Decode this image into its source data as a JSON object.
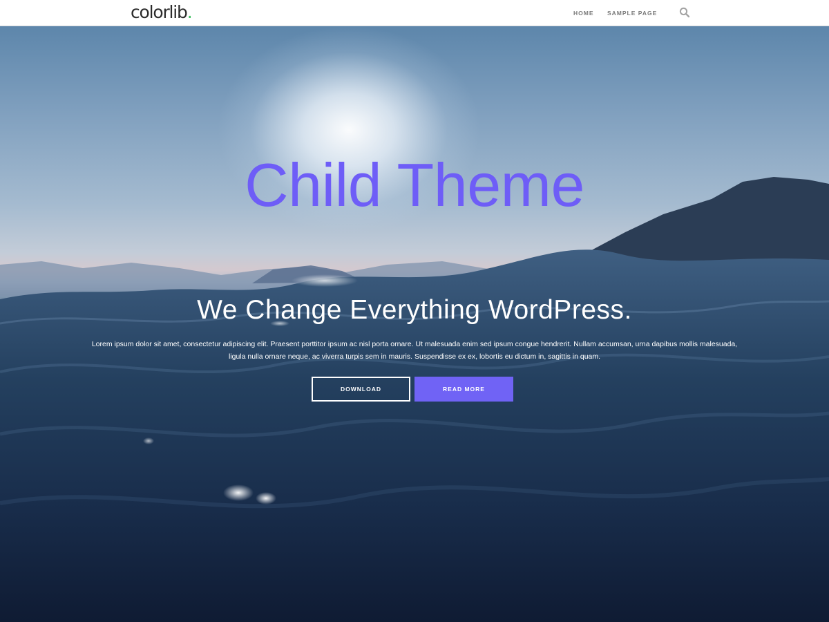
{
  "header": {
    "logo_text": "colorlib",
    "logo_dot": ".",
    "nav": [
      {
        "label": "HOME"
      },
      {
        "label": "SAMPLE PAGE"
      }
    ],
    "search_icon": "search-icon"
  },
  "hero": {
    "title": "Child Theme",
    "subtitle": "We Change Everything WordPress.",
    "text": "Lorem ipsum dolor sit amet, consectetur adipiscing elit. Praesent porttitor ipsum ac nisl porta ornare. Ut malesuada enim sed ipsum congue hendrerit. Nullam accumsan, urna dapibus mollis malesuada, ligula nulla ornare neque, ac viverra turpis sem in mauris. Suspendisse ex ex, lobortis eu dictum in, sagittis in quam.",
    "buttons": {
      "download": "DOWNLOAD",
      "read_more": "READ MORE"
    }
  },
  "colors": {
    "accent": "#6e5df7",
    "button_primary": "#7063f5",
    "logo_dot": "#3fbf5f"
  }
}
